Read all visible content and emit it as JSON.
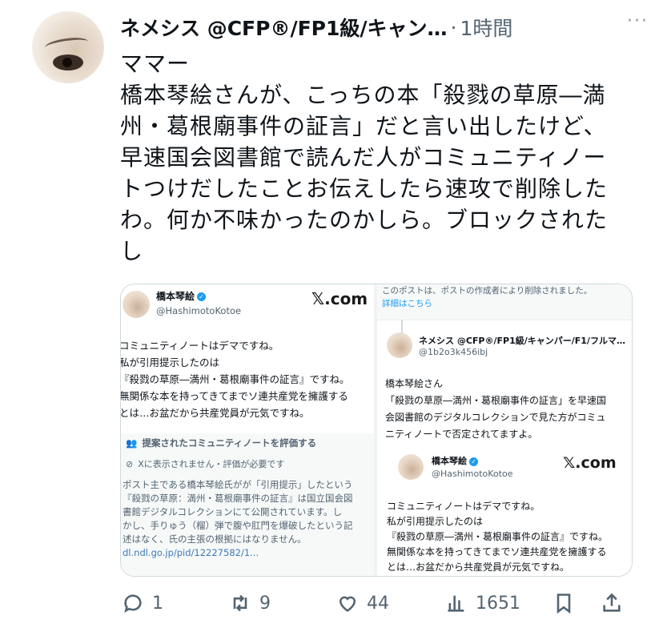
{
  "tweet": {
    "display_name": "ネメシス @CFP®/FP1級/キャン…",
    "time": "1時間",
    "more_label": "···",
    "lines": [
      "ママー",
      "橋本琴絵さんが、こっちの本「殺戮の草原―満",
      "州・葛根廟事件の証言」だと言い出したけど、",
      "早速国会図書館で読んだ人がコミュニティノー",
      "トつけだしたことお伝えしたら速攻で削除した",
      "わ。何か不味かったのかしら。ブロックされた",
      "し"
    ]
  },
  "left_panel": {
    "author_name": "橋本琴絵",
    "author_handle": "@HashimotoKotoe",
    "source": "𝕏.com",
    "post_lines": [
      "コミュニティノートはデマですね。",
      "私が引用提示したのは",
      "『殺戮の草原―満州・葛根廟事件の証言』ですね。",
      "無関係な本を持ってきてまでソ連共産党を擁護する",
      "とは…お盆だから共産党員が元気ですね。"
    ],
    "community_note": {
      "header": "提案されたコミュニティノートを評価する",
      "status": "Xに表示されません・評価が必要です",
      "body_lines": [
        "ポスト主である橋本琴絵氏がが「引用提示」したという",
        "『殺戮の草原：満州・葛根廟事件の証言』は国立国会図",
        "書館デジタルコレクションにて公開されています。し",
        "かし、手りゅう（榴）弾で腹や肛門を爆破したという記",
        "述はなく、氏の主張の根拠にはなりません。"
      ],
      "link": "dl.ndl.go.jp/pid/12227582/1..."
    }
  },
  "right_panel": {
    "deleted_notice": "このポストは、ポストの作成者により削除されました。",
    "details_link": "詳細はこちら",
    "reply_name": "ネメシス @CFP®/FP1級/キャンパー/F1/フルマ…",
    "reply_handle": "@1b2o3k456ibj",
    "reply_lines": [
      "橋本琴絵さん",
      "「殺戮の草原―満州・葛根廟事件の証言」を早速国",
      "会図書館のデジタルコレクションで見た方がコミュ",
      "ニティノートで否定されてますよ。"
    ],
    "inner_author_name": "橋本琴絵",
    "inner_author_handle": "@HashimotoKotoe",
    "inner_source": "𝕏.com",
    "inner_post_lines": [
      "コミュニティノートはデマですね。",
      "私が引用提示したのは",
      "『殺戮の草原―満州・葛根廟事件の証言』ですね。",
      "無関係な本を持ってきてまでソ連共産党を擁護する",
      "とは…お盆だから共産党員が元気ですね。"
    ]
  },
  "actions": {
    "reply_count": "1",
    "retweet_count": "9",
    "like_count": "44",
    "views_count": "1651"
  },
  "icons": {
    "reply": "reply-icon",
    "retweet": "retweet-icon",
    "like": "heart-icon",
    "views": "views-icon",
    "bookmark": "bookmark-icon",
    "share": "share-icon"
  },
  "colors": {
    "accent": "#1d9bf0",
    "muted": "#536471",
    "border": "#cfd9de"
  }
}
